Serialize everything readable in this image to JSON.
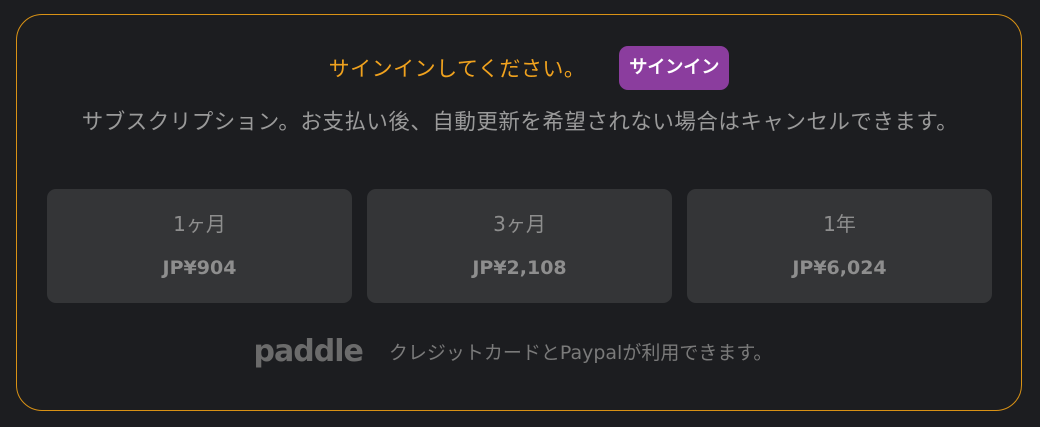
{
  "signin": {
    "prompt": "サインインしてください。",
    "button_label": "サインイン"
  },
  "description": "サブスクリプション。お支払い後、自動更新を希望されない場合はキャンセルできます。",
  "plans": [
    {
      "duration": "1ヶ月",
      "price": "JP¥904"
    },
    {
      "duration": "3ヶ月",
      "price": "JP¥2,108"
    },
    {
      "duration": "1年",
      "price": "JP¥6,024"
    }
  ],
  "footer": {
    "logo": "paddle",
    "text": "クレジットカードとPaypalが利用できます。"
  },
  "colors": {
    "background": "#1c1d20",
    "border_accent": "#d99215",
    "prompt": "#f0a21e",
    "signin_button": "#8b3d9e",
    "card": "#343537"
  }
}
